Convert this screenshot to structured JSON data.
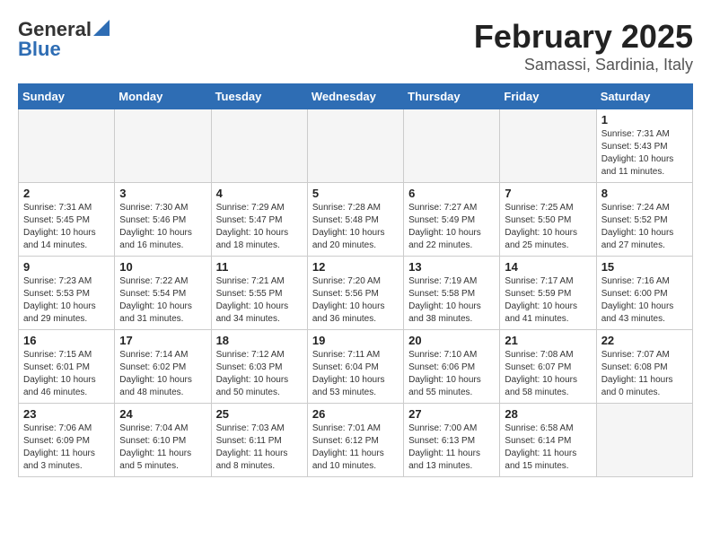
{
  "header": {
    "logo_general": "General",
    "logo_blue": "Blue",
    "month": "February 2025",
    "location": "Samassi, Sardinia, Italy"
  },
  "days_of_week": [
    "Sunday",
    "Monday",
    "Tuesday",
    "Wednesday",
    "Thursday",
    "Friday",
    "Saturday"
  ],
  "weeks": [
    [
      {
        "day": "",
        "info": ""
      },
      {
        "day": "",
        "info": ""
      },
      {
        "day": "",
        "info": ""
      },
      {
        "day": "",
        "info": ""
      },
      {
        "day": "",
        "info": ""
      },
      {
        "day": "",
        "info": ""
      },
      {
        "day": "1",
        "info": "Sunrise: 7:31 AM\nSunset: 5:43 PM\nDaylight: 10 hours\nand 11 minutes."
      }
    ],
    [
      {
        "day": "2",
        "info": "Sunrise: 7:31 AM\nSunset: 5:45 PM\nDaylight: 10 hours\nand 14 minutes."
      },
      {
        "day": "3",
        "info": "Sunrise: 7:30 AM\nSunset: 5:46 PM\nDaylight: 10 hours\nand 16 minutes."
      },
      {
        "day": "4",
        "info": "Sunrise: 7:29 AM\nSunset: 5:47 PM\nDaylight: 10 hours\nand 18 minutes."
      },
      {
        "day": "5",
        "info": "Sunrise: 7:28 AM\nSunset: 5:48 PM\nDaylight: 10 hours\nand 20 minutes."
      },
      {
        "day": "6",
        "info": "Sunrise: 7:27 AM\nSunset: 5:49 PM\nDaylight: 10 hours\nand 22 minutes."
      },
      {
        "day": "7",
        "info": "Sunrise: 7:25 AM\nSunset: 5:50 PM\nDaylight: 10 hours\nand 25 minutes."
      },
      {
        "day": "8",
        "info": "Sunrise: 7:24 AM\nSunset: 5:52 PM\nDaylight: 10 hours\nand 27 minutes."
      }
    ],
    [
      {
        "day": "9",
        "info": "Sunrise: 7:23 AM\nSunset: 5:53 PM\nDaylight: 10 hours\nand 29 minutes."
      },
      {
        "day": "10",
        "info": "Sunrise: 7:22 AM\nSunset: 5:54 PM\nDaylight: 10 hours\nand 31 minutes."
      },
      {
        "day": "11",
        "info": "Sunrise: 7:21 AM\nSunset: 5:55 PM\nDaylight: 10 hours\nand 34 minutes."
      },
      {
        "day": "12",
        "info": "Sunrise: 7:20 AM\nSunset: 5:56 PM\nDaylight: 10 hours\nand 36 minutes."
      },
      {
        "day": "13",
        "info": "Sunrise: 7:19 AM\nSunset: 5:58 PM\nDaylight: 10 hours\nand 38 minutes."
      },
      {
        "day": "14",
        "info": "Sunrise: 7:17 AM\nSunset: 5:59 PM\nDaylight: 10 hours\nand 41 minutes."
      },
      {
        "day": "15",
        "info": "Sunrise: 7:16 AM\nSunset: 6:00 PM\nDaylight: 10 hours\nand 43 minutes."
      }
    ],
    [
      {
        "day": "16",
        "info": "Sunrise: 7:15 AM\nSunset: 6:01 PM\nDaylight: 10 hours\nand 46 minutes."
      },
      {
        "day": "17",
        "info": "Sunrise: 7:14 AM\nSunset: 6:02 PM\nDaylight: 10 hours\nand 48 minutes."
      },
      {
        "day": "18",
        "info": "Sunrise: 7:12 AM\nSunset: 6:03 PM\nDaylight: 10 hours\nand 50 minutes."
      },
      {
        "day": "19",
        "info": "Sunrise: 7:11 AM\nSunset: 6:04 PM\nDaylight: 10 hours\nand 53 minutes."
      },
      {
        "day": "20",
        "info": "Sunrise: 7:10 AM\nSunset: 6:06 PM\nDaylight: 10 hours\nand 55 minutes."
      },
      {
        "day": "21",
        "info": "Sunrise: 7:08 AM\nSunset: 6:07 PM\nDaylight: 10 hours\nand 58 minutes."
      },
      {
        "day": "22",
        "info": "Sunrise: 7:07 AM\nSunset: 6:08 PM\nDaylight: 11 hours\nand 0 minutes."
      }
    ],
    [
      {
        "day": "23",
        "info": "Sunrise: 7:06 AM\nSunset: 6:09 PM\nDaylight: 11 hours\nand 3 minutes."
      },
      {
        "day": "24",
        "info": "Sunrise: 7:04 AM\nSunset: 6:10 PM\nDaylight: 11 hours\nand 5 minutes."
      },
      {
        "day": "25",
        "info": "Sunrise: 7:03 AM\nSunset: 6:11 PM\nDaylight: 11 hours\nand 8 minutes."
      },
      {
        "day": "26",
        "info": "Sunrise: 7:01 AM\nSunset: 6:12 PM\nDaylight: 11 hours\nand 10 minutes."
      },
      {
        "day": "27",
        "info": "Sunrise: 7:00 AM\nSunset: 6:13 PM\nDaylight: 11 hours\nand 13 minutes."
      },
      {
        "day": "28",
        "info": "Sunrise: 6:58 AM\nSunset: 6:14 PM\nDaylight: 11 hours\nand 15 minutes."
      },
      {
        "day": "",
        "info": ""
      }
    ]
  ]
}
